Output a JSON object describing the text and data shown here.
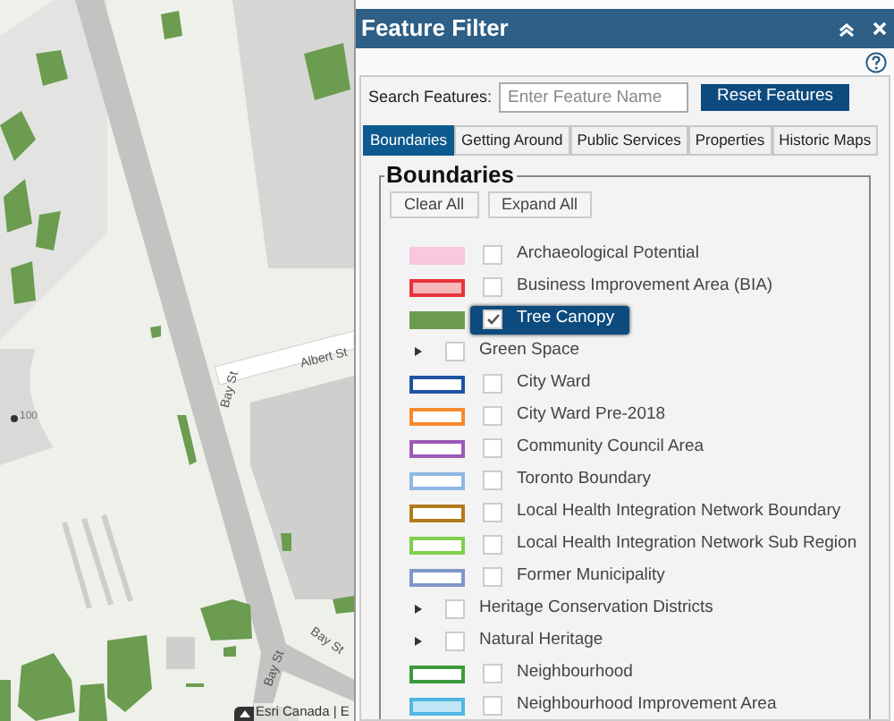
{
  "map": {
    "labels": [
      {
        "text": "Albert St",
        "kind": "street"
      },
      {
        "text": "Bay St",
        "kind": "street"
      },
      {
        "text": "Bay St",
        "kind": "street"
      },
      {
        "text": "Bay St",
        "kind": "street"
      },
      {
        "text": "100",
        "kind": "address"
      }
    ],
    "attribution": "Esri Canada | E"
  },
  "panel": {
    "title": "Feature Filter",
    "search": {
      "label": "Search Features:",
      "placeholder": "Enter Feature Name",
      "button": "Reset Features"
    },
    "tabs": [
      {
        "label": "Boundaries",
        "selected": true
      },
      {
        "label": "Getting Around",
        "selected": false
      },
      {
        "label": "Public Services",
        "selected": false
      },
      {
        "label": "Properties",
        "selected": false
      },
      {
        "label": "Historic Maps",
        "selected": false
      }
    ],
    "section": {
      "title": "Boundaries",
      "buttons": [
        "Clear All",
        "Expand All"
      ],
      "items": [
        {
          "kind": "solid",
          "label": "Archaeological Potential",
          "color": "#f7c8de",
          "checked": false,
          "selected": false
        },
        {
          "kind": "tinted",
          "label": "Business Improvement Area (BIA)",
          "color": "#e6343c",
          "checked": false,
          "selected": false
        },
        {
          "kind": "solid",
          "label": "Tree Canopy",
          "color": "#6b9c50",
          "checked": true,
          "selected": true
        },
        {
          "kind": "group",
          "label": "Green Space",
          "checked": false,
          "expanded": false
        },
        {
          "kind": "outline",
          "label": "City Ward",
          "color": "#1f52a3",
          "checked": false,
          "selected": false
        },
        {
          "kind": "outline",
          "label": "City Ward Pre-2018",
          "color": "#f58a2c",
          "checked": false,
          "selected": false
        },
        {
          "kind": "outline",
          "label": "Community Council Area",
          "color": "#9c5ab5",
          "checked": false,
          "selected": false
        },
        {
          "kind": "outline",
          "label": "Toronto Boundary",
          "color": "#8fb8e3",
          "checked": false,
          "selected": false
        },
        {
          "kind": "outline",
          "label": "Local Health Integration Network Boundary",
          "color": "#b17b1c",
          "checked": false,
          "selected": false
        },
        {
          "kind": "outline",
          "label": "Local Health Integration Network Sub Region",
          "color": "#7fd04c",
          "checked": false,
          "selected": false
        },
        {
          "kind": "outline",
          "label": "Former Municipality",
          "color": "#7f96c9",
          "checked": false,
          "selected": false
        },
        {
          "kind": "group",
          "label": "Heritage Conservation Districts",
          "checked": false,
          "expanded": false
        },
        {
          "kind": "group",
          "label": "Natural Heritage",
          "checked": false,
          "expanded": false
        },
        {
          "kind": "outline",
          "label": "Neighbourhood",
          "color": "#3a9b3a",
          "checked": false,
          "selected": false
        },
        {
          "kind": "tinted",
          "label": "Neighbourhood Improvement Area",
          "color": "#4fb8e2",
          "checked": false,
          "selected": false
        }
      ]
    }
  }
}
